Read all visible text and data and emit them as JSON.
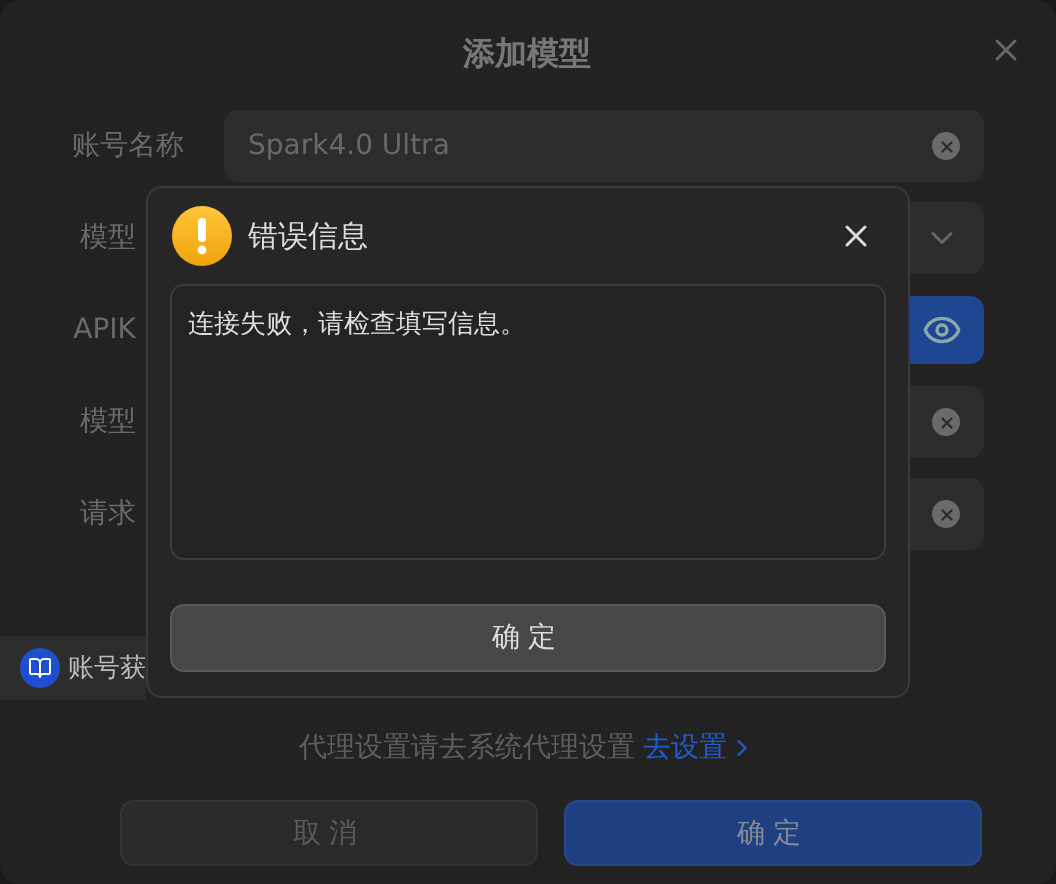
{
  "dialog": {
    "title": "添加模型",
    "fields": [
      {
        "label": "账号名称",
        "kind": "text",
        "value": "Spark4.0 Ultra"
      },
      {
        "label": "模型",
        "kind": "select"
      },
      {
        "label": "APIK",
        "kind": "password"
      },
      {
        "label": "模型",
        "kind": "text"
      },
      {
        "label": "请求",
        "kind": "text"
      }
    ],
    "side_tab": {
      "label": "账号获"
    },
    "proxy_note": {
      "text": "代理设置请去系统代理设置",
      "link": "去设置"
    },
    "buttons": [
      {
        "label": "取消",
        "kind": "secondary"
      },
      {
        "label": "确定",
        "kind": "primary"
      }
    ]
  },
  "error_dialog": {
    "title": "错误信息",
    "message": "连接失败，请检查填写信息。",
    "button": "确定"
  }
}
